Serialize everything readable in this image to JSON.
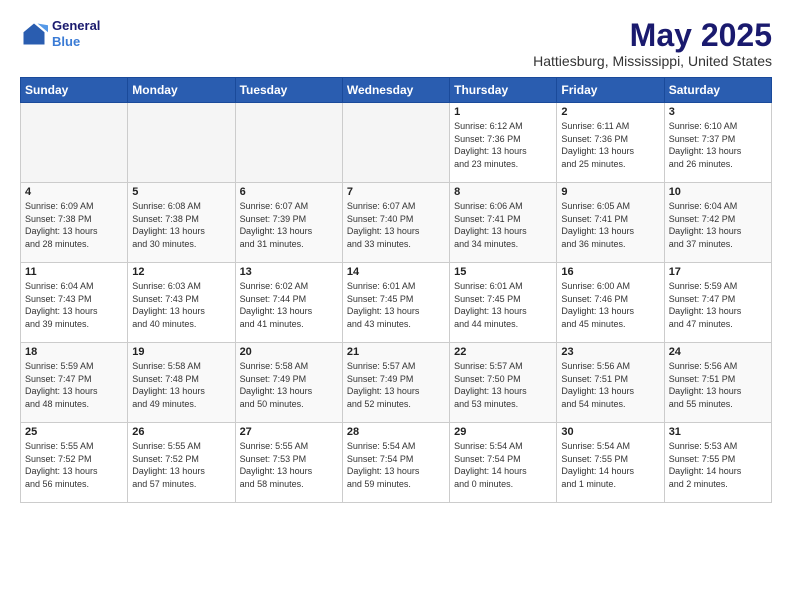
{
  "header": {
    "logo_line1": "General",
    "logo_line2": "Blue",
    "title": "May 2025",
    "subtitle": "Hattiesburg, Mississippi, United States"
  },
  "weekdays": [
    "Sunday",
    "Monday",
    "Tuesday",
    "Wednesday",
    "Thursday",
    "Friday",
    "Saturday"
  ],
  "weeks": [
    [
      {
        "day": "",
        "info": ""
      },
      {
        "day": "",
        "info": ""
      },
      {
        "day": "",
        "info": ""
      },
      {
        "day": "",
        "info": ""
      },
      {
        "day": "1",
        "info": "Sunrise: 6:12 AM\nSunset: 7:36 PM\nDaylight: 13 hours\nand 23 minutes."
      },
      {
        "day": "2",
        "info": "Sunrise: 6:11 AM\nSunset: 7:36 PM\nDaylight: 13 hours\nand 25 minutes."
      },
      {
        "day": "3",
        "info": "Sunrise: 6:10 AM\nSunset: 7:37 PM\nDaylight: 13 hours\nand 26 minutes."
      }
    ],
    [
      {
        "day": "4",
        "info": "Sunrise: 6:09 AM\nSunset: 7:38 PM\nDaylight: 13 hours\nand 28 minutes."
      },
      {
        "day": "5",
        "info": "Sunrise: 6:08 AM\nSunset: 7:38 PM\nDaylight: 13 hours\nand 30 minutes."
      },
      {
        "day": "6",
        "info": "Sunrise: 6:07 AM\nSunset: 7:39 PM\nDaylight: 13 hours\nand 31 minutes."
      },
      {
        "day": "7",
        "info": "Sunrise: 6:07 AM\nSunset: 7:40 PM\nDaylight: 13 hours\nand 33 minutes."
      },
      {
        "day": "8",
        "info": "Sunrise: 6:06 AM\nSunset: 7:41 PM\nDaylight: 13 hours\nand 34 minutes."
      },
      {
        "day": "9",
        "info": "Sunrise: 6:05 AM\nSunset: 7:41 PM\nDaylight: 13 hours\nand 36 minutes."
      },
      {
        "day": "10",
        "info": "Sunrise: 6:04 AM\nSunset: 7:42 PM\nDaylight: 13 hours\nand 37 minutes."
      }
    ],
    [
      {
        "day": "11",
        "info": "Sunrise: 6:04 AM\nSunset: 7:43 PM\nDaylight: 13 hours\nand 39 minutes."
      },
      {
        "day": "12",
        "info": "Sunrise: 6:03 AM\nSunset: 7:43 PM\nDaylight: 13 hours\nand 40 minutes."
      },
      {
        "day": "13",
        "info": "Sunrise: 6:02 AM\nSunset: 7:44 PM\nDaylight: 13 hours\nand 41 minutes."
      },
      {
        "day": "14",
        "info": "Sunrise: 6:01 AM\nSunset: 7:45 PM\nDaylight: 13 hours\nand 43 minutes."
      },
      {
        "day": "15",
        "info": "Sunrise: 6:01 AM\nSunset: 7:45 PM\nDaylight: 13 hours\nand 44 minutes."
      },
      {
        "day": "16",
        "info": "Sunrise: 6:00 AM\nSunset: 7:46 PM\nDaylight: 13 hours\nand 45 minutes."
      },
      {
        "day": "17",
        "info": "Sunrise: 5:59 AM\nSunset: 7:47 PM\nDaylight: 13 hours\nand 47 minutes."
      }
    ],
    [
      {
        "day": "18",
        "info": "Sunrise: 5:59 AM\nSunset: 7:47 PM\nDaylight: 13 hours\nand 48 minutes."
      },
      {
        "day": "19",
        "info": "Sunrise: 5:58 AM\nSunset: 7:48 PM\nDaylight: 13 hours\nand 49 minutes."
      },
      {
        "day": "20",
        "info": "Sunrise: 5:58 AM\nSunset: 7:49 PM\nDaylight: 13 hours\nand 50 minutes."
      },
      {
        "day": "21",
        "info": "Sunrise: 5:57 AM\nSunset: 7:49 PM\nDaylight: 13 hours\nand 52 minutes."
      },
      {
        "day": "22",
        "info": "Sunrise: 5:57 AM\nSunset: 7:50 PM\nDaylight: 13 hours\nand 53 minutes."
      },
      {
        "day": "23",
        "info": "Sunrise: 5:56 AM\nSunset: 7:51 PM\nDaylight: 13 hours\nand 54 minutes."
      },
      {
        "day": "24",
        "info": "Sunrise: 5:56 AM\nSunset: 7:51 PM\nDaylight: 13 hours\nand 55 minutes."
      }
    ],
    [
      {
        "day": "25",
        "info": "Sunrise: 5:55 AM\nSunset: 7:52 PM\nDaylight: 13 hours\nand 56 minutes."
      },
      {
        "day": "26",
        "info": "Sunrise: 5:55 AM\nSunset: 7:52 PM\nDaylight: 13 hours\nand 57 minutes."
      },
      {
        "day": "27",
        "info": "Sunrise: 5:55 AM\nSunset: 7:53 PM\nDaylight: 13 hours\nand 58 minutes."
      },
      {
        "day": "28",
        "info": "Sunrise: 5:54 AM\nSunset: 7:54 PM\nDaylight: 13 hours\nand 59 minutes."
      },
      {
        "day": "29",
        "info": "Sunrise: 5:54 AM\nSunset: 7:54 PM\nDaylight: 14 hours\nand 0 minutes."
      },
      {
        "day": "30",
        "info": "Sunrise: 5:54 AM\nSunset: 7:55 PM\nDaylight: 14 hours\nand 1 minute."
      },
      {
        "day": "31",
        "info": "Sunrise: 5:53 AM\nSunset: 7:55 PM\nDaylight: 14 hours\nand 2 minutes."
      }
    ]
  ]
}
